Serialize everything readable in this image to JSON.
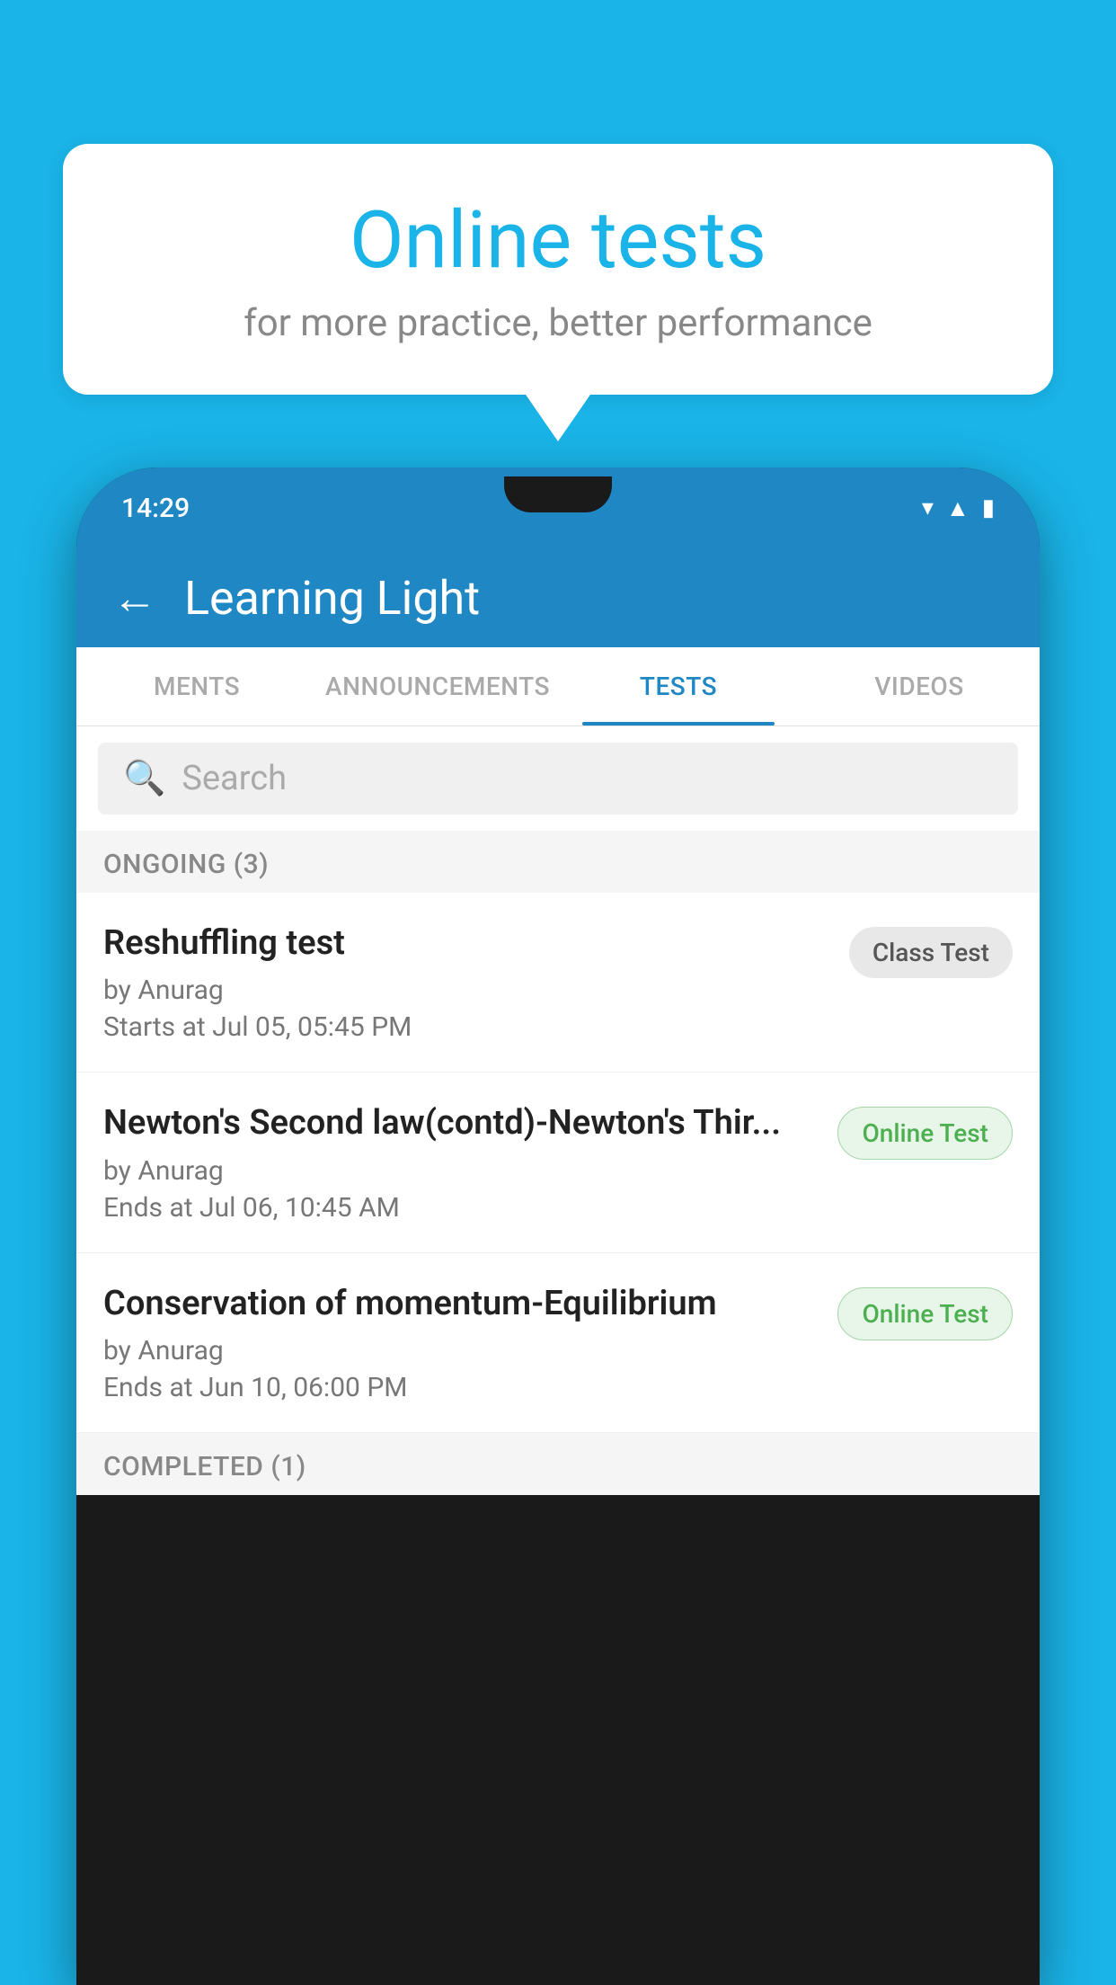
{
  "background": {
    "color": "#1ab4e8"
  },
  "speech_bubble": {
    "title": "Online tests",
    "subtitle": "for more practice, better performance"
  },
  "phone": {
    "status_bar": {
      "time": "14:29",
      "icons": [
        "wifi",
        "signal",
        "battery"
      ]
    },
    "header": {
      "back_label": "←",
      "title": "Learning Light"
    },
    "tabs": [
      {
        "label": "MENTS",
        "active": false
      },
      {
        "label": "ANNOUNCEMENTS",
        "active": false
      },
      {
        "label": "TESTS",
        "active": true
      },
      {
        "label": "VIDEOS",
        "active": false
      }
    ],
    "search": {
      "placeholder": "Search"
    },
    "ongoing_section": {
      "label": "ONGOING (3)",
      "tests": [
        {
          "name": "Reshuffling test",
          "by": "by Anurag",
          "time": "Starts at  Jul 05, 05:45 PM",
          "badge": "Class Test",
          "badge_type": "class"
        },
        {
          "name": "Newton's Second law(contd)-Newton's Thir...",
          "by": "by Anurag",
          "time": "Ends at  Jul 06, 10:45 AM",
          "badge": "Online Test",
          "badge_type": "online"
        },
        {
          "name": "Conservation of momentum-Equilibrium",
          "by": "by Anurag",
          "time": "Ends at  Jun 10, 06:00 PM",
          "badge": "Online Test",
          "badge_type": "online"
        }
      ]
    },
    "completed_section": {
      "label": "COMPLETED (1)"
    }
  }
}
